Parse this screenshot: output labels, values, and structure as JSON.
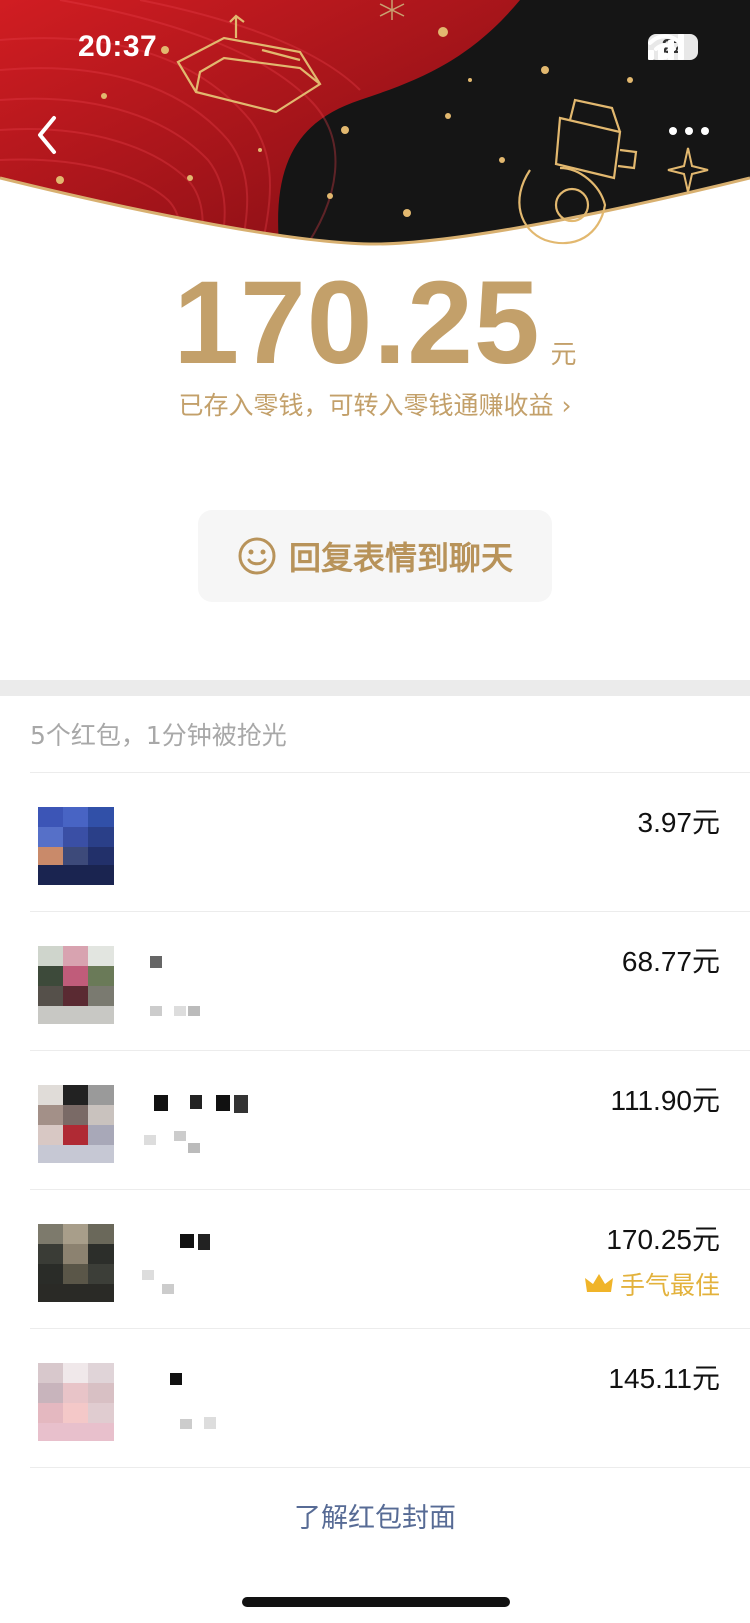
{
  "status_bar": {
    "time": "20:37",
    "battery": "22"
  },
  "colors": {
    "gold": "#c3a06a",
    "header_red": "#b0141b",
    "header_black": "#1a1a1a",
    "link_blue": "#576b95",
    "best_gold": "#e3b23c"
  },
  "envelope": {
    "amount": "170.25",
    "unit": "元",
    "saved_text": "已存入零钱，可转入零钱通赚收益 ›"
  },
  "reply_button": {
    "label": "回复表情到聊天"
  },
  "summary": "5个红包，1分钟被抢光",
  "records": [
    {
      "amount": "3.97元",
      "best": ""
    },
    {
      "amount": "68.77元",
      "best": ""
    },
    {
      "amount": "111.90元",
      "best": ""
    },
    {
      "amount": "170.25元",
      "best": "手气最佳"
    },
    {
      "amount": "145.11元",
      "best": ""
    }
  ],
  "footer_link": "了解红包封面"
}
